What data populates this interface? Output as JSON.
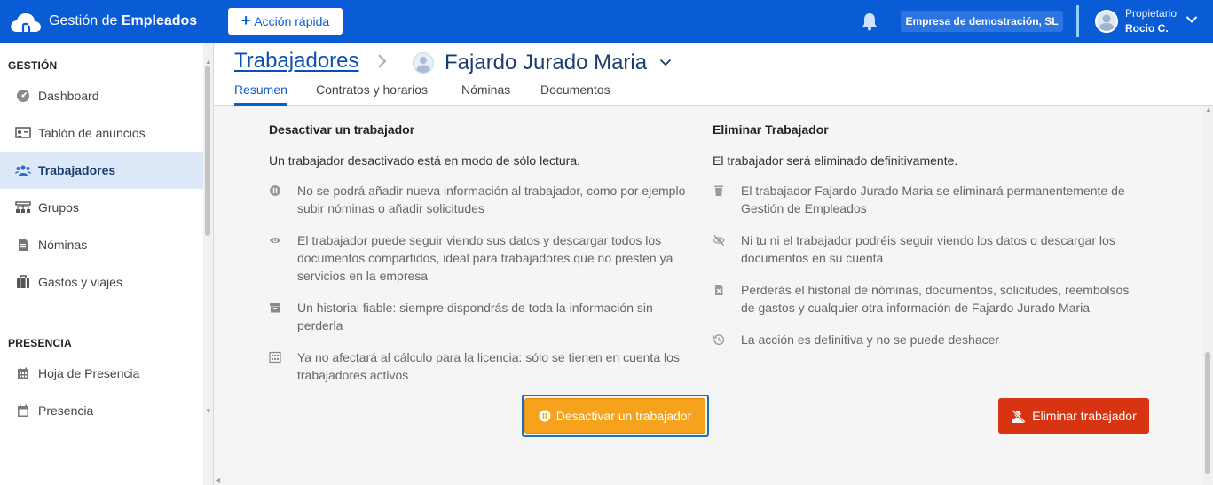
{
  "topbar": {
    "brand_prefix": "Gestión de ",
    "brand_bold": "Empleados",
    "quick_action_label": "Acción rápida",
    "company": "Empresa de demostración, SL",
    "user_role": "Propietario",
    "user_name": "Rocio C.",
    "bg_color": "#0a5bd6"
  },
  "sidebar": {
    "section_gestion": "GESTIÓN",
    "gestion_items": [
      {
        "label": "Dashboard",
        "icon": "dashboard-gauge-icon"
      },
      {
        "label": "Tablón de anuncios",
        "icon": "announcement-board-icon"
      },
      {
        "label": "Trabajadores",
        "icon": "users-icon",
        "active": true
      },
      {
        "label": "Grupos",
        "icon": "groups-icon"
      },
      {
        "label": "Nóminas",
        "icon": "payslip-document-icon"
      },
      {
        "label": "Gastos y viajes",
        "icon": "briefcase-icon"
      }
    ],
    "section_presencia": "PRESENCIA",
    "presencia_items": [
      {
        "label": "Hoja de Presencia",
        "icon": "calendar-grid-icon"
      },
      {
        "label": "Presencia",
        "icon": "calendar-icon"
      }
    ]
  },
  "header": {
    "breadcrumb_link": "Trabajadores",
    "employee_name": "Fajardo Jurado Maria",
    "tabs": [
      {
        "label": "Resumen",
        "active": true
      },
      {
        "label": "Contratos y horarios"
      },
      {
        "label": "Nóminas"
      },
      {
        "label": "Documentos"
      }
    ]
  },
  "deactivate": {
    "title": "Desactivar un trabajador",
    "subtitle": "Un trabajador desactivado está en modo de sólo lectura.",
    "bullets": [
      {
        "icon": "pause-icon",
        "text": "No se podrá añadir nueva información al trabajador, como por ejemplo subir nóminas o añadir solicitudes"
      },
      {
        "icon": "eye-icon",
        "text": "El trabajador puede seguir viendo sus datos y descargar todos los documentos compartidos, ideal para trabajadores que no presten ya servicios en la empresa"
      },
      {
        "icon": "archive-icon",
        "text": "Un historial fiable: siempre dispondrás de toda la información sin perderla"
      },
      {
        "icon": "calculator-icon",
        "text": "Ya no afectará al cálculo para la licencia: sólo se tienen en cuenta los trabajadores activos"
      }
    ],
    "button_label": "Desactivar un trabajador",
    "button_color": "#f7a21c"
  },
  "delete": {
    "title": "Eliminar Trabajador",
    "subtitle": "El trabajador será eliminado definitivamente.",
    "bullets": [
      {
        "icon": "trash-icon",
        "text": "El trabajador Fajardo Jurado Maria se eliminará permanentemente de Gestión de Empleados"
      },
      {
        "icon": "eye-slash-icon",
        "text": "Ni tu ni el trabajador podréis seguir viendo los datos o descargar los documentos en su cuenta"
      },
      {
        "icon": "file-delete-icon",
        "text": "Perderás el historial de nóminas, documentos, solicitudes, reembolsos de gastos y cualquier otra información de Fajardo Jurado Maria"
      },
      {
        "icon": "history-icon",
        "text": "La acción es definitiva y no se puede deshacer"
      }
    ],
    "button_label": "Eliminar trabajador",
    "button_color": "#d93412"
  }
}
